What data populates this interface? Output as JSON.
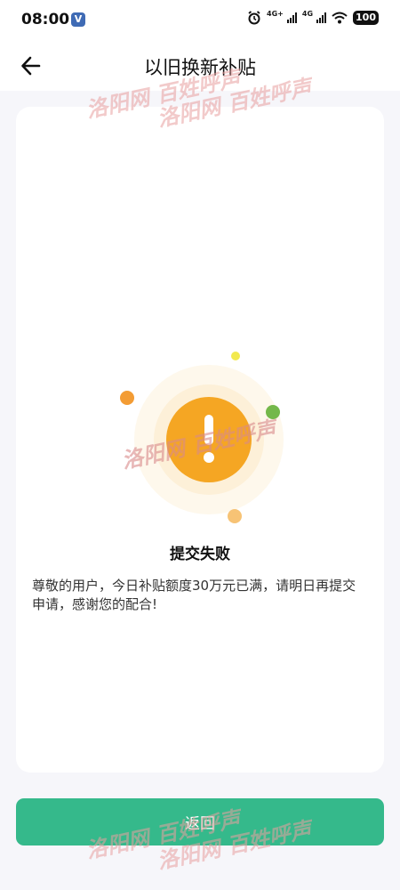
{
  "status_bar": {
    "time": "08:00",
    "app_badge": "V",
    "network_1": "4G+",
    "network_2": "4G",
    "battery": "100"
  },
  "nav": {
    "title": "以旧换新补贴",
    "back_icon": "arrow-left-icon"
  },
  "result": {
    "icon": "warning-exclamation-icon",
    "accent_color": "#f5a623",
    "title": "提交失败",
    "message": "尊敬的用户，今日补贴额度30万元已满，请明日再提交申请，感谢您的配合!"
  },
  "actions": {
    "return_label": "返回",
    "button_color": "#35b98b"
  },
  "watermarks": [
    "洛阳网 百姓呼声",
    "洛阳网 百姓呼声",
    "洛阳网 百姓呼声",
    "洛阳网 百姓呼声",
    "洛阳网 百姓呼声"
  ]
}
